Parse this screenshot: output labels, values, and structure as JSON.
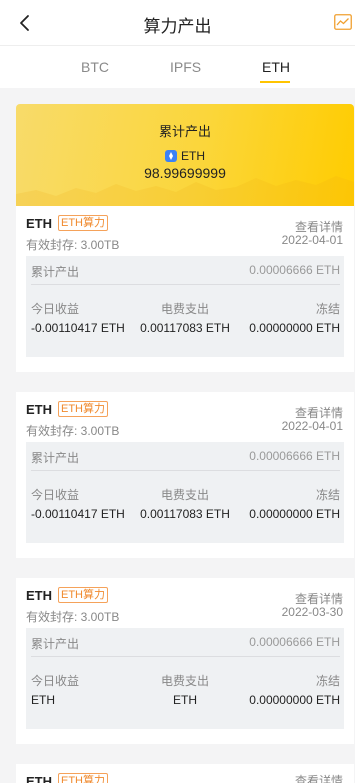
{
  "header": {
    "title": "算力产出",
    "back_icon": "back-arrow-icon",
    "chart_icon": "chart-icon"
  },
  "tabs": [
    {
      "label": "BTC",
      "active": false
    },
    {
      "label": "IPFS",
      "active": false
    },
    {
      "label": "ETH",
      "active": true
    }
  ],
  "summary": {
    "label": "累计产出",
    "coin": "ETH",
    "value": "98.99699999"
  },
  "colors": {
    "accent": "#ffc400",
    "badge": "#f08a2e"
  },
  "cards": [
    {
      "coin": "ETH",
      "badge": "ETH算力",
      "storage": "有效封存: 3.00TB",
      "detail": "查看详情",
      "date": "2022-04-01",
      "cum_label": "累计产出",
      "cum_value": "0.00006666 ETH",
      "h1": "今日收益",
      "h2": "电费支出",
      "h3": "冻结",
      "v1": "-0.00110417 ETH",
      "v2": "0.00117083 ETH",
      "v3": "0.00000000 ETH"
    },
    {
      "coin": "ETH",
      "badge": "ETH算力",
      "storage": "有效封存: 3.00TB",
      "detail": "查看详情",
      "date": "2022-04-01",
      "cum_label": "累计产出",
      "cum_value": "0.00006666 ETH",
      "h1": "今日收益",
      "h2": "电费支出",
      "h3": "冻结",
      "v1": "-0.00110417 ETH",
      "v2": "0.00117083 ETH",
      "v3": "0.00000000 ETH"
    },
    {
      "coin": "ETH",
      "badge": "ETH算力",
      "storage": "有效封存: 3.00TB",
      "detail": "查看详情",
      "date": "2022-03-30",
      "cum_label": "累计产出",
      "cum_value": "0.00006666 ETH",
      "h1": "今日收益",
      "h2": "电费支出",
      "h3": "冻结",
      "v1": "ETH",
      "v2": "ETH",
      "v3": "0.00000000 ETH"
    },
    {
      "coin": "ETH",
      "badge": "ETH算力",
      "detail": "查看详情"
    }
  ]
}
